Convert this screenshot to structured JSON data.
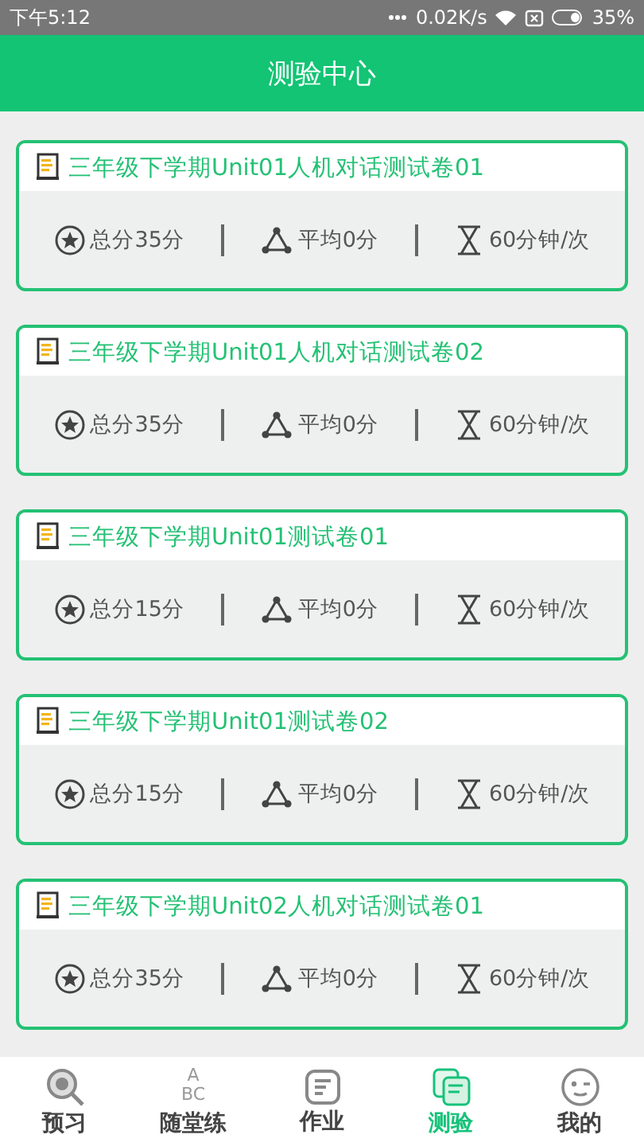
{
  "status_bar": {
    "time": "下午5:12",
    "network_speed": "0.02K/s",
    "battery": "35%"
  },
  "header": {
    "title": "测验中心"
  },
  "tests": [
    {
      "title": "三年级下学期Unit01人机对话测试卷01",
      "total": "总分35分",
      "average": "平均0分",
      "duration": "60分钟/次"
    },
    {
      "title": "三年级下学期Unit01人机对话测试卷02",
      "total": "总分35分",
      "average": "平均0分",
      "duration": "60分钟/次"
    },
    {
      "title": "三年级下学期Unit01测试卷01",
      "total": "总分15分",
      "average": "平均0分",
      "duration": "60分钟/次"
    },
    {
      "title": "三年级下学期Unit01测试卷02",
      "total": "总分15分",
      "average": "平均0分",
      "duration": "60分钟/次"
    },
    {
      "title": "三年级下学期Unit02人机对话测试卷01",
      "total": "总分35分",
      "average": "平均0分",
      "duration": "60分钟/次"
    }
  ],
  "bottom_nav": [
    {
      "label": "预习",
      "kind": "search",
      "selected": false
    },
    {
      "label": "随堂练",
      "kind": "letters",
      "icon_letters": [
        "A",
        "BC"
      ],
      "selected": false
    },
    {
      "label": "作业",
      "kind": "list",
      "selected": false
    },
    {
      "label": "测验",
      "kind": "papers",
      "selected": true
    },
    {
      "label": "我的",
      "kind": "face",
      "selected": false
    }
  ]
}
